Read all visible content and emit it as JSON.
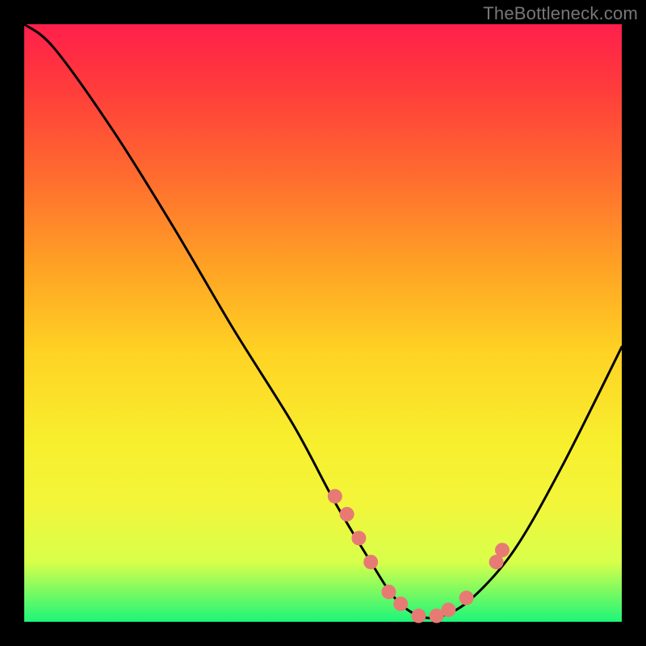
{
  "watermark": "TheBottleneck.com",
  "chart_data": {
    "type": "line",
    "title": "",
    "xlabel": "",
    "ylabel": "",
    "xlim": [
      0,
      100
    ],
    "ylim": [
      0,
      100
    ],
    "series": [
      {
        "name": "bottleneck-curve",
        "x": [
          0,
          5,
          15,
          25,
          35,
          45,
          52,
          58,
          62,
          66,
          70,
          75,
          82,
          90,
          100
        ],
        "y": [
          100,
          96,
          82,
          66,
          49,
          33,
          20,
          10,
          4,
          1,
          1,
          4,
          12,
          26,
          46
        ]
      }
    ],
    "markers": {
      "name": "highlight-points",
      "x": [
        52,
        54,
        56,
        58,
        61,
        63,
        66,
        69,
        71,
        74,
        79,
        80
      ],
      "y": [
        21,
        18,
        14,
        10,
        5,
        3,
        1,
        1,
        2,
        4,
        10,
        12
      ],
      "color": "#e77b74",
      "radius": 9
    },
    "gradient_stops": [
      {
        "pos": 0.0,
        "color": "#ff1f4b"
      },
      {
        "pos": 0.55,
        "color": "#ffd324"
      },
      {
        "pos": 1.0,
        "color": "#1cf57a"
      }
    ]
  }
}
